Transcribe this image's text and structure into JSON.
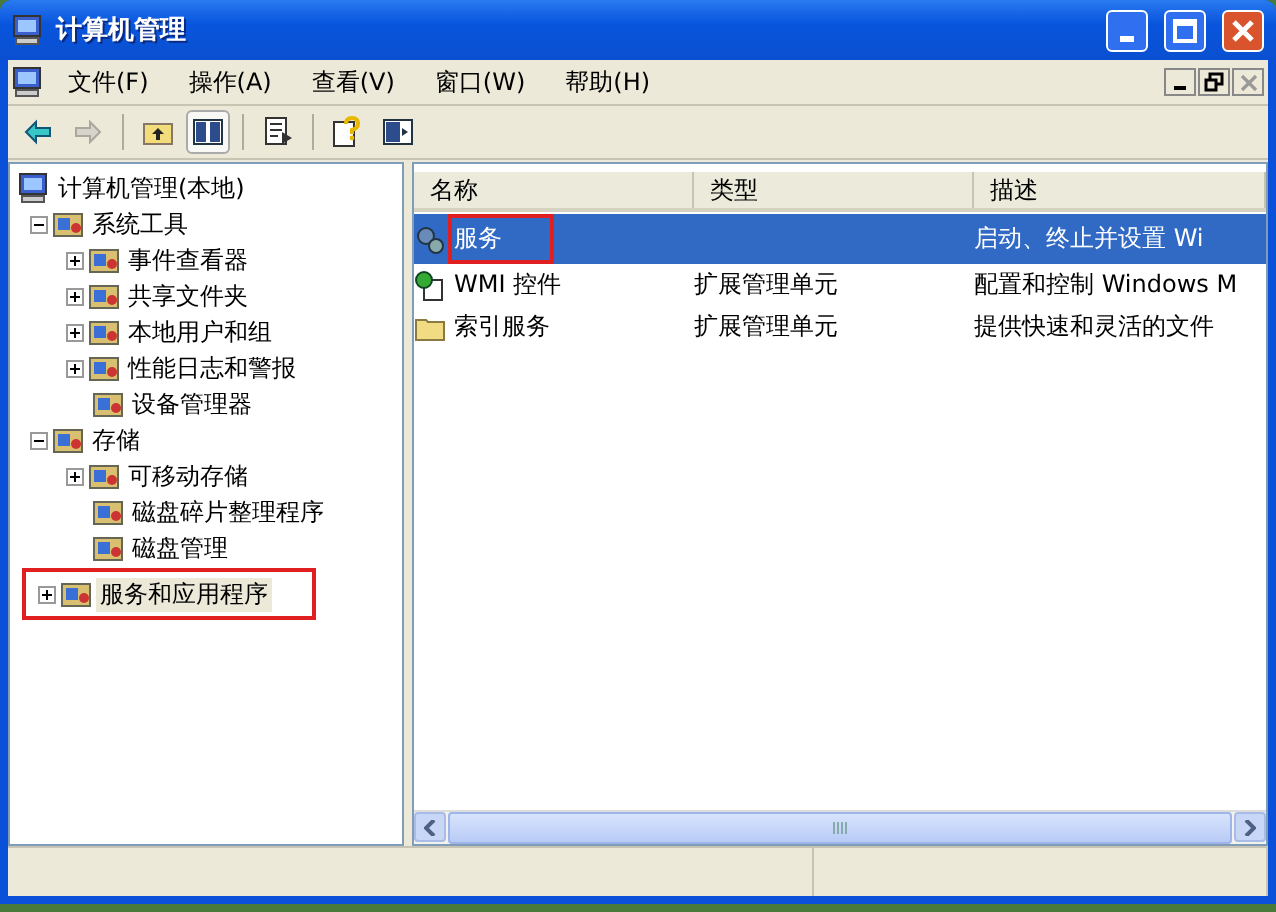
{
  "window": {
    "title": "计算机管理"
  },
  "menu": [
    {
      "label": "文件(F)"
    },
    {
      "label": "操作(A)"
    },
    {
      "label": "查看(V)"
    },
    {
      "label": "窗口(W)"
    },
    {
      "label": "帮助(H)"
    }
  ],
  "toolbar": [
    {
      "kind": "back",
      "disabled": false
    },
    {
      "kind": "forward",
      "disabled": true
    },
    {
      "kind": "sep"
    },
    {
      "kind": "up",
      "disabled": false
    },
    {
      "kind": "tree",
      "disabled": false
    },
    {
      "kind": "sep"
    },
    {
      "kind": "export",
      "disabled": false
    },
    {
      "kind": "sep"
    },
    {
      "kind": "help",
      "disabled": false
    },
    {
      "kind": "panel",
      "disabled": false
    }
  ],
  "tree": [
    {
      "label": "计算机管理(本地)",
      "children": [
        {
          "label": "系统工具",
          "expanded": true,
          "children": [
            {
              "label": "事件查看器",
              "expanded": false
            },
            {
              "label": "共享文件夹",
              "expanded": false
            },
            {
              "label": "本地用户和组",
              "expanded": false
            },
            {
              "label": "性能日志和警报",
              "expanded": false
            },
            {
              "label": "设备管理器"
            }
          ]
        },
        {
          "label": "存储",
          "expanded": true,
          "children": [
            {
              "label": "可移动存储",
              "expanded": false
            },
            {
              "label": "磁盘碎片整理程序"
            },
            {
              "label": "磁盘管理"
            }
          ]
        },
        {
          "label": "服务和应用程序",
          "expanded": false,
          "selected": true,
          "highlighted": true
        }
      ]
    }
  ],
  "list": {
    "columns": [
      "名称",
      "类型",
      "描述"
    ],
    "rows": [
      {
        "name": "服务",
        "type": "",
        "description": "启动、终止并设置 Wi",
        "selected": true,
        "highlighted": true
      },
      {
        "name": "WMI 控件",
        "type": "扩展管理单元",
        "description": "配置和控制 Windows M",
        "selected": false,
        "highlighted": false
      },
      {
        "name": "索引服务",
        "type": "扩展管理单元",
        "description": "提供快速和灵活的文件",
        "selected": false,
        "highlighted": false
      }
    ]
  }
}
